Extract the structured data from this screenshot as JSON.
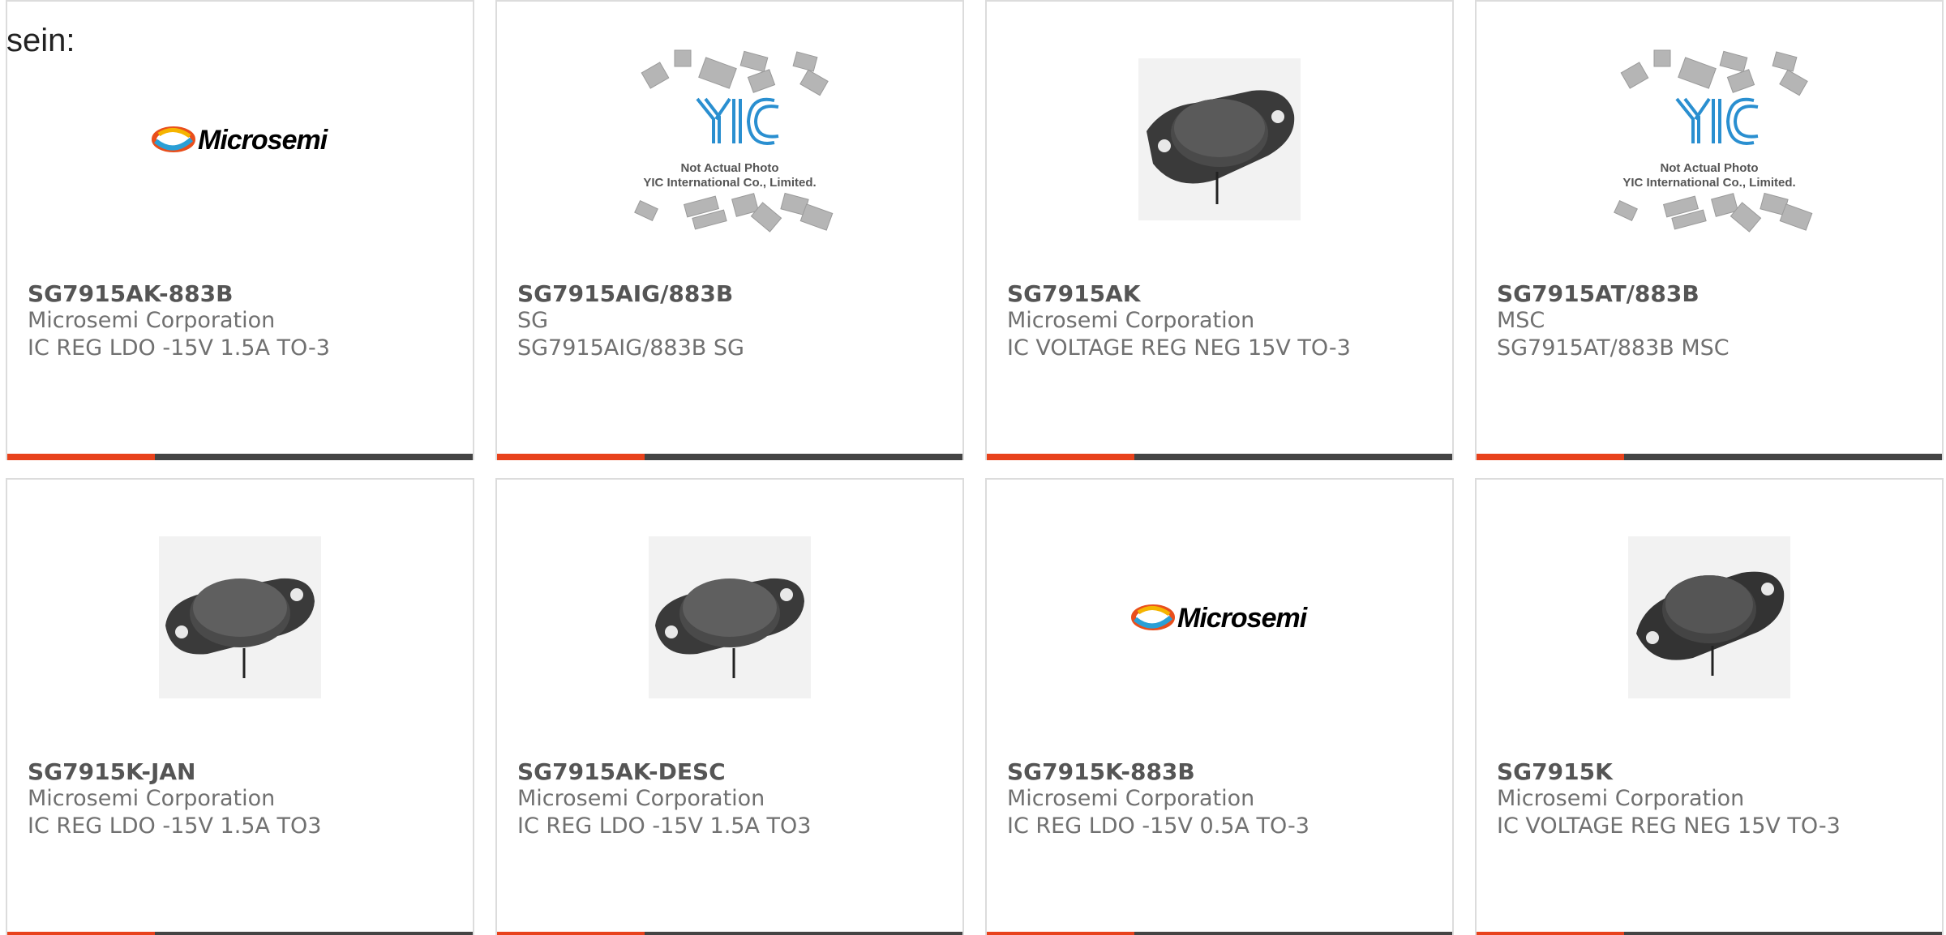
{
  "intro_text": "sein:",
  "colors": {
    "accent": "#e8421c",
    "bar_dark": "#444444",
    "card_border": "#dcdcdc"
  },
  "logo_text": "Microsemi",
  "placeholder_caption": {
    "line1": "Not Actual Photo",
    "line2": "YIC International Co., Limited."
  },
  "products": [
    {
      "part": "SG7915AK-883B",
      "manufacturer": "Microsemi Corporation",
      "description": "IC REG LDO -15V 1.5A TO-3",
      "image": "microsemi-logo"
    },
    {
      "part": "SG7915AIG/883B",
      "manufacturer": "SG",
      "description": "SG7915AIG/883B SG",
      "image": "yic-placeholder"
    },
    {
      "part": "SG7915AK",
      "manufacturer": "Microsemi Corporation",
      "description": "IC VOLTAGE REG NEG 15V TO-3",
      "image": "to3-package"
    },
    {
      "part": "SG7915AT/883B",
      "manufacturer": "MSC",
      "description": "SG7915AT/883B MSC",
      "image": "yic-placeholder"
    },
    {
      "part": "SG7915K-JAN",
      "manufacturer": "Microsemi Corporation",
      "description": "IC REG LDO -15V 1.5A TO3",
      "image": "to3-package"
    },
    {
      "part": "SG7915AK-DESC",
      "manufacturer": "Microsemi Corporation",
      "description": "IC REG LDO -15V 1.5A TO3",
      "image": "to3-package"
    },
    {
      "part": "SG7915K-883B",
      "manufacturer": "Microsemi Corporation",
      "description": "IC REG LDO -15V 0.5A TO-3",
      "image": "microsemi-logo"
    },
    {
      "part": "SG7915K",
      "manufacturer": "Microsemi Corporation",
      "description": "IC VOLTAGE REG NEG 15V TO-3",
      "image": "to3-package"
    }
  ]
}
